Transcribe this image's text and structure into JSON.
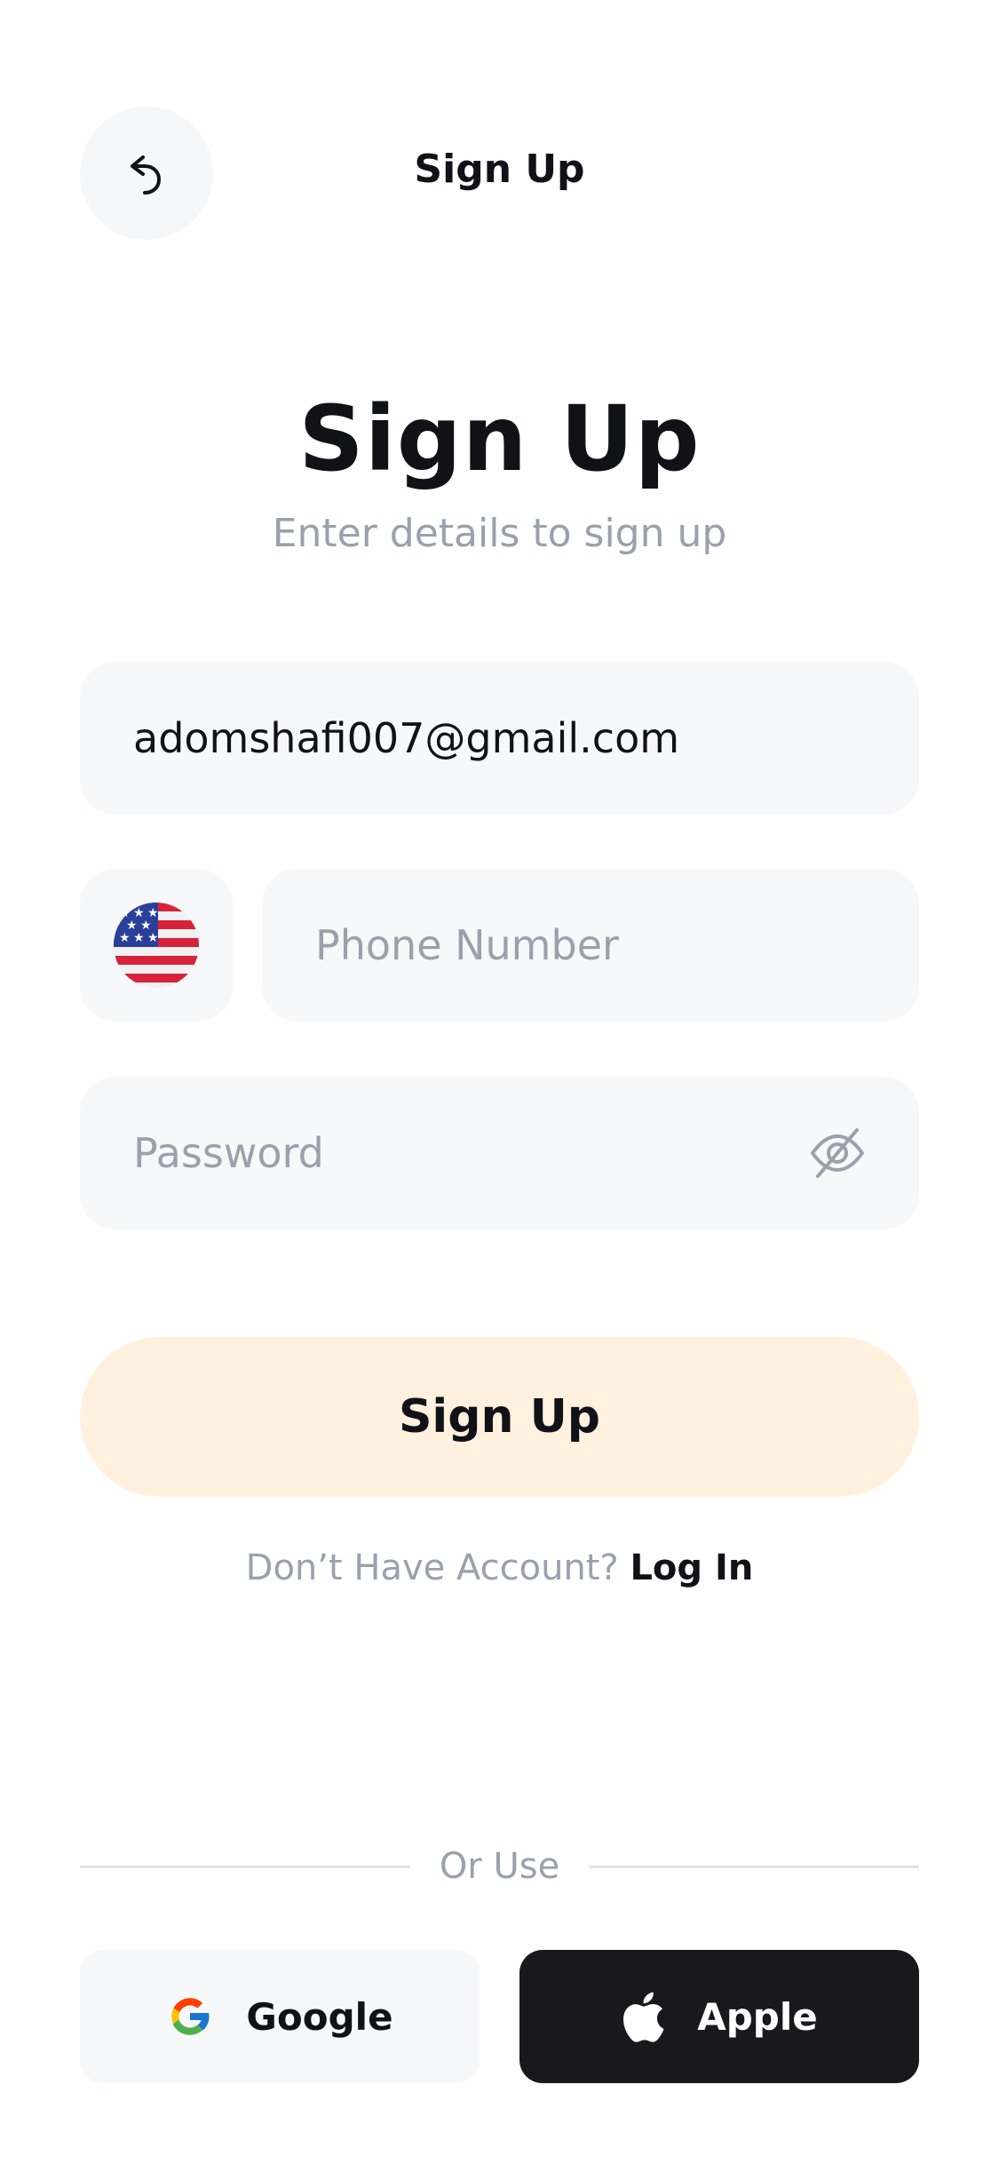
{
  "header": {
    "title": "Sign Up",
    "back_icon": "undo-arrow-icon"
  },
  "main": {
    "title": "Sign Up",
    "subtitle": "Enter details to sign up"
  },
  "form": {
    "email_value": "adomshafi007@gmail.com",
    "country_flag": "us-flag-icon",
    "phone_placeholder": "Phone Number",
    "password_placeholder": "Password",
    "password_toggle_icon": "eye-off-icon",
    "submit_label": "Sign Up"
  },
  "account": {
    "question": "Don’t Have Account?",
    "login_label": "Log In"
  },
  "social": {
    "divider_label": "Or Use",
    "google_label": "Google",
    "apple_label": "Apple"
  },
  "colors": {
    "primary_text": "#111118",
    "muted_text": "#9aa0ac",
    "field_bg": "#f7f8fa",
    "signup_btn_bg": "#fff1de",
    "apple_btn_bg": "#19181c"
  }
}
